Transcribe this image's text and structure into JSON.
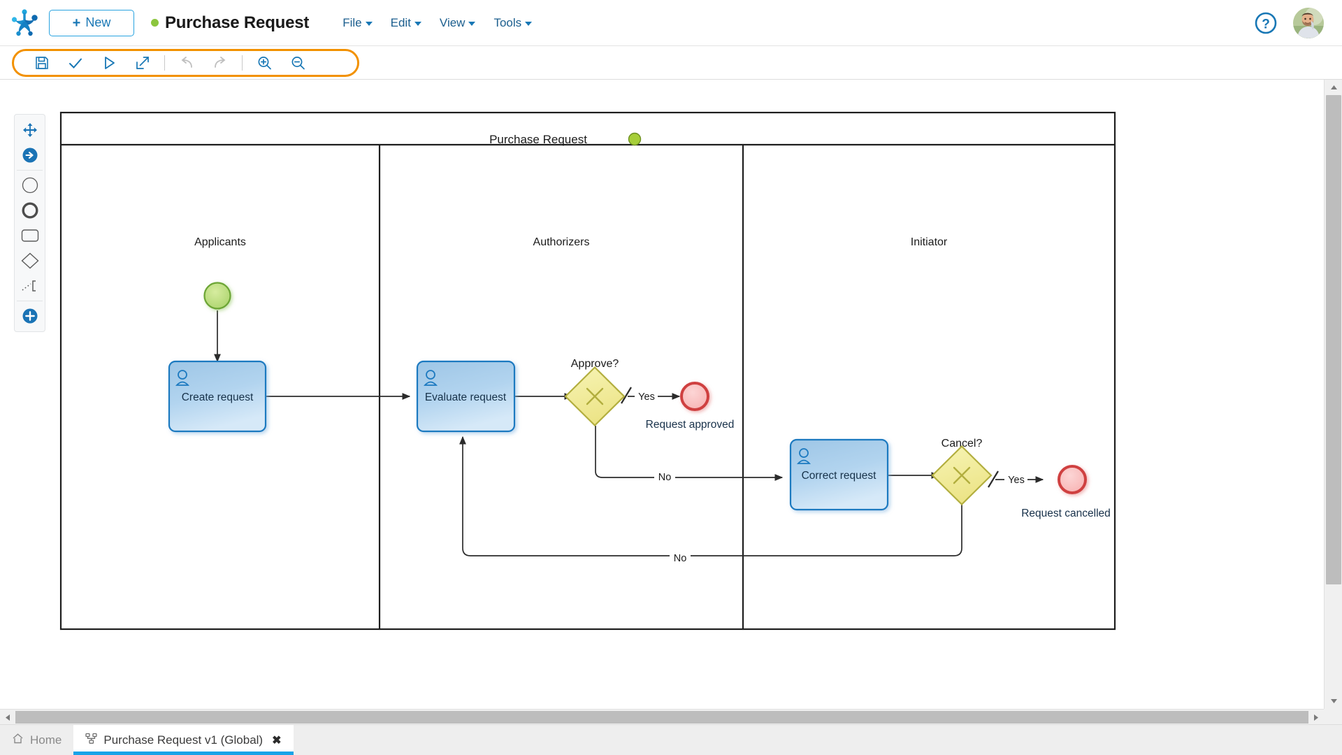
{
  "header": {
    "logo_name": "frog-foot-logo",
    "new_button": "New",
    "document_title": "Purchase Request",
    "status_dot_color": "#8cc63e",
    "menus": [
      {
        "label": "File"
      },
      {
        "label": "Edit"
      },
      {
        "label": "View"
      },
      {
        "label": "Tools"
      }
    ],
    "help_label": "?",
    "avatar_name": "user-avatar"
  },
  "toolbar": {
    "highlight_color": "#f29100",
    "buttons": [
      {
        "name": "save-button",
        "icon": "save-icon",
        "enabled": true
      },
      {
        "name": "validate-button",
        "icon": "check-icon",
        "enabled": true
      },
      {
        "name": "run-button",
        "icon": "play-icon",
        "enabled": true
      },
      {
        "name": "export-button",
        "icon": "export-icon",
        "enabled": true
      },
      {
        "name": "undo-button",
        "icon": "undo-icon",
        "enabled": false
      },
      {
        "name": "redo-button",
        "icon": "redo-icon",
        "enabled": false
      },
      {
        "name": "zoom-in-button",
        "icon": "zoom-in-icon",
        "enabled": true
      },
      {
        "name": "zoom-out-button",
        "icon": "zoom-out-icon",
        "enabled": true
      }
    ]
  },
  "palette": {
    "items": [
      {
        "name": "palette-move-tool",
        "icon": "move-arrows-icon"
      },
      {
        "name": "palette-sequence-flow",
        "icon": "arrow-right-circle-icon"
      },
      {
        "name": "palette-start-event",
        "icon": "thin-circle-icon"
      },
      {
        "name": "palette-end-event",
        "icon": "thick-circle-icon"
      },
      {
        "name": "palette-task",
        "icon": "rounded-rectangle-icon"
      },
      {
        "name": "palette-gateway",
        "icon": "diamond-icon"
      },
      {
        "name": "palette-artifact",
        "icon": "dotted-bracket-icon"
      },
      {
        "name": "palette-add-more",
        "icon": "plus-circle-icon"
      }
    ]
  },
  "diagram": {
    "pool": {
      "label": "Purchase Request",
      "status_dot_color": "#8cc63e"
    },
    "lanes": [
      {
        "label": "Applicants"
      },
      {
        "label": "Authorizers"
      },
      {
        "label": "Initiator"
      }
    ],
    "nodes": [
      {
        "id": "start",
        "type": "start-event",
        "label": "",
        "lane": "Applicants"
      },
      {
        "id": "create",
        "type": "user-task",
        "label": "Create request",
        "lane": "Applicants"
      },
      {
        "id": "evaluate",
        "type": "user-task",
        "label": "Evaluate request",
        "lane": "Authorizers"
      },
      {
        "id": "approve",
        "type": "gateway-xor",
        "label": "Approve?",
        "lane": "Authorizers"
      },
      {
        "id": "approved",
        "type": "end-event",
        "label": "Request approved",
        "lane": "Authorizers"
      },
      {
        "id": "correct",
        "type": "user-task",
        "label": "Correct request",
        "lane": "Initiator"
      },
      {
        "id": "cancel",
        "type": "gateway-xor",
        "label": "Cancel?",
        "lane": "Initiator"
      },
      {
        "id": "cancelled",
        "type": "end-event",
        "label": "Request cancelled",
        "lane": "Initiator"
      }
    ],
    "flows": [
      {
        "from": "start",
        "to": "create",
        "label": ""
      },
      {
        "from": "create",
        "to": "evaluate",
        "label": ""
      },
      {
        "from": "evaluate",
        "to": "approve",
        "label": ""
      },
      {
        "from": "approve",
        "to": "approved",
        "label": "Yes"
      },
      {
        "from": "approve",
        "to": "correct",
        "label": "No"
      },
      {
        "from": "correct",
        "to": "cancel",
        "label": ""
      },
      {
        "from": "cancel",
        "to": "cancelled",
        "label": "Yes"
      },
      {
        "from": "cancel",
        "to": "evaluate",
        "label": "No"
      }
    ],
    "colors": {
      "task_fill": "#aacde8",
      "task_stroke": "#1f7ac0",
      "gateway_fill": "#f4f0a0",
      "gateway_stroke": "#b2ae3e",
      "start_fill": "#bee08a",
      "start_stroke": "#62a331",
      "end_fill": "#f9b9b9",
      "end_stroke": "#cf4040",
      "flow_stroke": "#2b2b2b"
    }
  },
  "tabs": [
    {
      "name": "tab-home",
      "label": "Home",
      "icon": "home-icon",
      "active": false
    },
    {
      "name": "tab-model",
      "label": "Purchase Request v1 (Global)",
      "icon": "diagram-icon",
      "active": true,
      "closable": true,
      "close_label": "✖"
    }
  ]
}
